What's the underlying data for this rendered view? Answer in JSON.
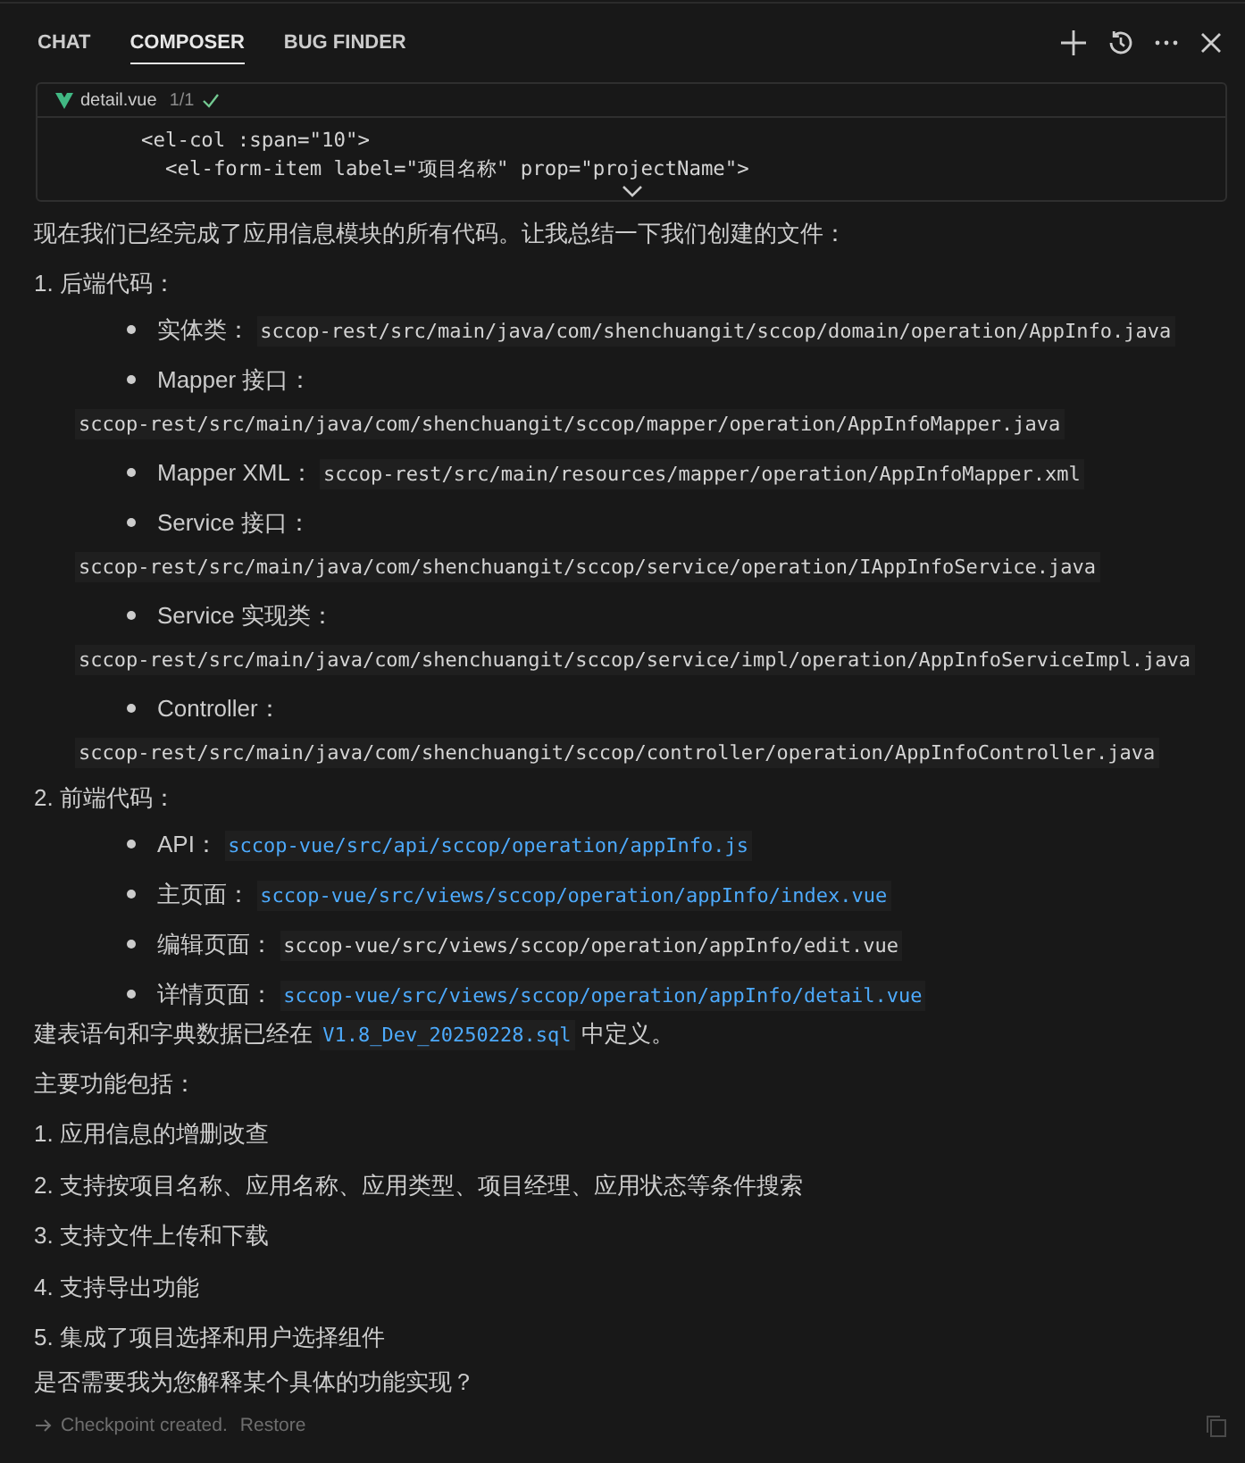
{
  "tabs": [
    {
      "label": "CHAT",
      "selected": false
    },
    {
      "label": "COMPOSER",
      "selected": true
    },
    {
      "label": "BUG FINDER",
      "selected": false
    }
  ],
  "file_card": {
    "filename": "detail.vue",
    "count": "1/1",
    "applied": true,
    "code_lines": [
      {
        "text": "<el-col :span=\"10\">",
        "children": [
          {
            "text": "<el-form-item label=\"项目名称\" prop=\"projectName\">"
          }
        ]
      }
    ]
  },
  "message": {
    "intro": "现在我们已经完成了应用信息模块的所有代码。让我总结一下我们创建的文件：",
    "sections": [
      {
        "heading": "1. 后端代码：",
        "items": [
          {
            "label": "实体类：",
            "path": "sccop-rest/src/main/java/com/shenchuangit/sccop/domain/operation/AppInfo.java",
            "linked": false
          },
          {
            "label": "Mapper 接口：",
            "path": "sccop-rest/src/main/java/com/shenchuangit/sccop/mapper/operation/AppInfoMapper.java",
            "linked": false
          },
          {
            "label": "Mapper XML：",
            "path": "sccop-rest/src/main/resources/mapper/operation/AppInfoMapper.xml",
            "linked": false
          },
          {
            "label": "Service 接口：",
            "path": "sccop-rest/src/main/java/com/shenchuangit/sccop/service/operation/IAppInfoService.java",
            "linked": false
          },
          {
            "label": "Service 实现类：",
            "path": "sccop-rest/src/main/java/com/shenchuangit/sccop/service/impl/operation/AppInfoServiceImpl.java",
            "linked": false
          },
          {
            "label": "Controller：",
            "path": "sccop-rest/src/main/java/com/shenchuangit/sccop/controller/operation/AppInfoController.java",
            "linked": false
          }
        ]
      },
      {
        "heading": "2. 前端代码：",
        "items": [
          {
            "label": "API：",
            "path": "sccop-vue/src/api/sccop/operation/appInfo.js",
            "linked": true
          },
          {
            "label": "主页面：",
            "path": "sccop-vue/src/views/sccop/operation/appInfo/index.vue",
            "linked": true
          },
          {
            "label": "编辑页面：",
            "path": "sccop-vue/src/views/sccop/operation/appInfo/edit.vue",
            "linked": false
          },
          {
            "label": "详情页面：",
            "path": "sccop-vue/src/views/sccop/operation/appInfo/detail.vue",
            "linked": true
          }
        ]
      }
    ],
    "sql_note": {
      "before": "建表语句和字典数据已经在",
      "file": "V1.8_Dev_20250228.sql",
      "after": "中定义。"
    },
    "features_heading": "主要功能包括：",
    "features": [
      "1. 应用信息的增删改查",
      "2. 支持按项目名称、应用名称、应用类型、项目经理、应用状态等条件搜索",
      "3. 支持文件上传和下载",
      "4. 支持导出功能",
      "5. 集成了项目选择和用户选择组件"
    ],
    "question": "是否需要我为您解释某个具体的功能实现？"
  },
  "checkpoint": {
    "text": "Checkpoint created.",
    "action": "Restore"
  }
}
